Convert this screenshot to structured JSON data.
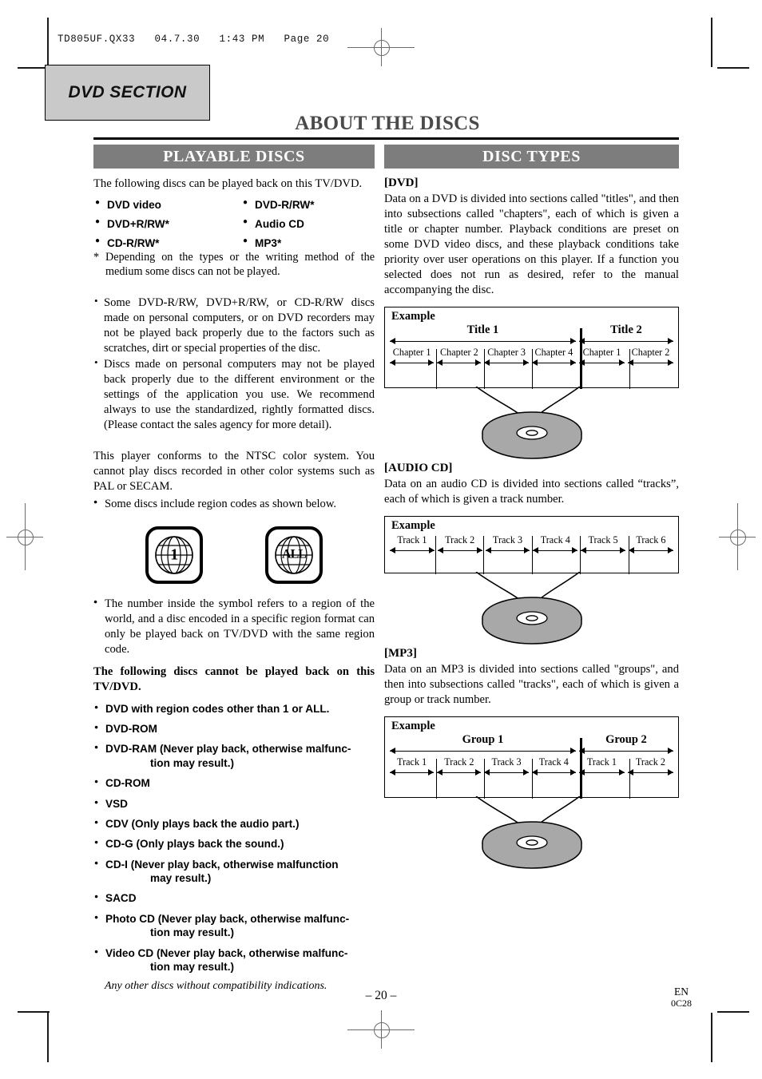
{
  "print_header": "TD805UF.QX33   04.7.30   1:43 PM   Page 20",
  "section_tab": "DVD SECTION",
  "page_title": "ABOUT THE DISCS",
  "left_column": {
    "bar_title": "PLAYABLE DISCS",
    "intro": "The following discs can be played back on this TV/DVD.",
    "playable_discs": [
      "DVD video",
      "DVD-R/RW*",
      "DVD+R/RW*",
      "Audio CD",
      "CD-R/RW*",
      "MP3*"
    ],
    "footnote": "* Depending on the types or the writing method of the medium some discs can not be played.",
    "notes": [
      "Some DVD-R/RW, DVD+R/RW, or CD-R/RW discs made on personal computers, or on DVD recorders may not be played back properly due to the factors such as scratches, dirt or special properties of the disc.",
      "Discs made on personal computers may not be played back properly due to the different environment or the settings of the application you use. We recommend always to use the standardized, rightly formatted discs. (Please contact the sales agency for more detail)."
    ],
    "ntsc_paragraph": "This player conforms to the NTSC color system. You cannot play discs recorded in other color systems such as PAL or SECAM.",
    "region_bullet": "Some discs include region codes as shown below.",
    "region_symbols": [
      {
        "label": "1",
        "name": "region-1-symbol"
      },
      {
        "label": "ALL",
        "name": "region-all-symbol"
      }
    ],
    "region_explanation": "The number inside the symbol refers to a region of the world, and a disc encoded in a specific region format can only be played back on TV/DVD with the same region code.",
    "cannot_play_heading": "The following discs cannot be played back on this TV/DVD.",
    "cannot_play_discs": [
      {
        "main": "DVD with region codes other than 1 or ALL.",
        "cont": ""
      },
      {
        "main": "DVD-ROM",
        "cont": ""
      },
      {
        "main": "DVD-RAM (Never play back, otherwise malfunc-",
        "cont": "tion may result.)"
      },
      {
        "main": "CD-ROM",
        "cont": ""
      },
      {
        "main": "VSD",
        "cont": ""
      },
      {
        "main": "CDV (Only plays back the audio part.)",
        "cont": ""
      },
      {
        "main": "CD-G (Only plays back the sound.)",
        "cont": ""
      },
      {
        "main": "CD-I (Never play back, otherwise malfunction",
        "cont": "may result.)"
      },
      {
        "main": "SACD",
        "cont": ""
      },
      {
        "main": "Photo CD (Never play back, otherwise malfunc-",
        "cont": "tion may result.)"
      },
      {
        "main": "Video CD (Never play back, otherwise malfunc-",
        "cont": "tion may result.)"
      }
    ],
    "closing_italic": "Any other discs without compatibility indications."
  },
  "right_column": {
    "bar_title": "DISC TYPES",
    "dvd": {
      "heading": "[DVD]",
      "body": "Data on a DVD is divided into sections called \"titles\", and then into subsections called \"chapters\", each of which is given a title or chapter number. Playback conditions are preset on some DVD video discs, and these playback conditions take priority over user operations on this player. If a function you selected does not run as desired, refer to the manual accompanying the disc.",
      "example_label": "Example",
      "groups": [
        {
          "name": "Title 1",
          "children": [
            "Chapter 1",
            "Chapter 2",
            "Chapter 3",
            "Chapter 4"
          ]
        },
        {
          "name": "Title 2",
          "children": [
            "Chapter 1",
            "Chapter 2"
          ]
        }
      ]
    },
    "audio_cd": {
      "heading": "[AUDIO CD]",
      "body": "Data on an audio CD is divided into sections called “tracks”, each of which is given a track number.",
      "example_label": "Example",
      "tracks": [
        "Track 1",
        "Track 2",
        "Track 3",
        "Track 4",
        "Track 5",
        "Track 6"
      ]
    },
    "mp3": {
      "heading": "[MP3]",
      "body": "Data on an MP3 is divided into sections called \"groups\", and then into subsections called \"tracks\", each of which is given a group or track number.",
      "example_label": "Example",
      "groups": [
        {
          "name": "Group 1",
          "children": [
            "Track 1",
            "Track 2",
            "Track 3",
            "Track 4"
          ]
        },
        {
          "name": "Group 2",
          "children": [
            "Track 1",
            "Track 2"
          ]
        }
      ]
    }
  },
  "footer": {
    "page_number": "– 20 –",
    "lang_code": "EN",
    "doc_code": "0C28"
  },
  "colors": {
    "bar_gray": "#7d7d7d",
    "tab_gray": "#c9c9c9",
    "title_gray": "#4a4a4a",
    "disc_gray": "#a8a8a8"
  }
}
